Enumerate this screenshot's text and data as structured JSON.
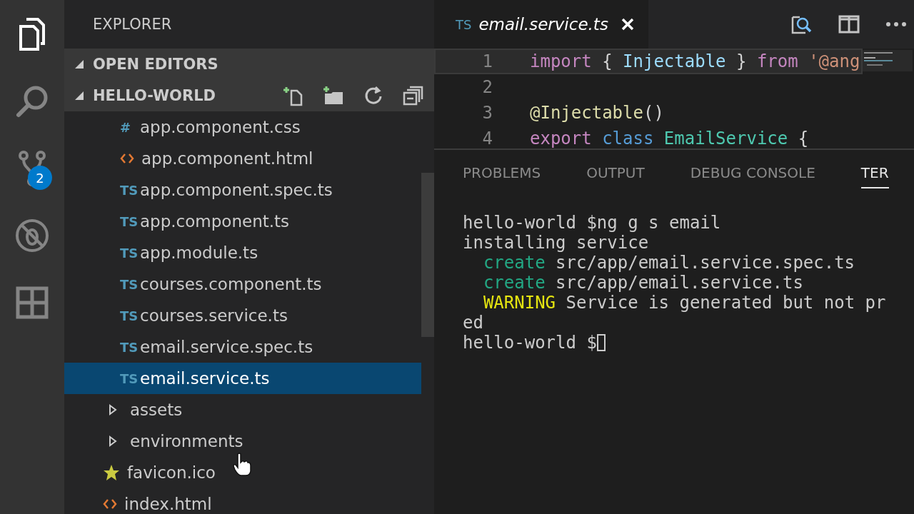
{
  "activity_bar": {
    "items": [
      {
        "kind": "files",
        "selected": true
      },
      {
        "kind": "search",
        "selected": false
      },
      {
        "kind": "scm",
        "selected": false,
        "badge": "2"
      },
      {
        "kind": "debug",
        "selected": false
      },
      {
        "kind": "extensions",
        "selected": false
      }
    ]
  },
  "sidebar": {
    "title": "EXPLORER",
    "sections": [
      {
        "label": "OPEN EDITORS",
        "expanded": true
      },
      {
        "label": "HELLO-WORLD",
        "expanded": true
      }
    ],
    "files": [
      {
        "name": "app.component.css",
        "kind": "css",
        "icon": "#",
        "selected": false
      },
      {
        "name": "app.component.html",
        "kind": "html",
        "selected": false
      },
      {
        "name": "app.component.spec.ts",
        "kind": "ts",
        "icon": "TS",
        "selected": false
      },
      {
        "name": "app.component.ts",
        "kind": "ts",
        "icon": "TS",
        "selected": false
      },
      {
        "name": "app.module.ts",
        "kind": "ts",
        "icon": "TS",
        "selected": false
      },
      {
        "name": "courses.component.ts",
        "kind": "ts",
        "icon": "TS",
        "selected": false
      },
      {
        "name": "courses.service.ts",
        "kind": "ts",
        "icon": "TS",
        "selected": false
      },
      {
        "name": "email.service.spec.ts",
        "kind": "ts",
        "icon": "TS",
        "selected": false
      },
      {
        "name": "email.service.ts",
        "kind": "ts",
        "icon": "TS",
        "selected": true
      },
      {
        "name": "assets",
        "kind": "folder",
        "expanded": false,
        "selected": false
      },
      {
        "name": "environments",
        "kind": "folder",
        "expanded": false,
        "selected": false
      },
      {
        "name": "favicon.ico",
        "kind": "favicon",
        "selected": false
      },
      {
        "name": "index.html",
        "kind": "html",
        "selected": false
      }
    ]
  },
  "editor": {
    "tab": {
      "icon": "TS",
      "title": "email.service.ts",
      "preview": true
    },
    "lines": [
      {
        "number": "1",
        "current": true,
        "tokens": [
          {
            "text": "import",
            "kind": "keyword"
          },
          {
            "text": " { ",
            "kind": "plain"
          },
          {
            "text": "Injectable",
            "kind": "variable"
          },
          {
            "text": " } ",
            "kind": "plain"
          },
          {
            "text": "from",
            "kind": "keyword"
          },
          {
            "text": " '@ang",
            "kind": "string"
          }
        ]
      },
      {
        "number": "2",
        "current": false
      },
      {
        "number": "3",
        "current": false,
        "tokens": [
          {
            "text": "@Injectable",
            "kind": "function"
          },
          {
            "text": "()",
            "kind": "plain"
          }
        ]
      },
      {
        "number": "4",
        "current": false,
        "tokens": [
          {
            "text": "export",
            "kind": "keyword"
          },
          {
            "text": " class",
            "kind": "storage"
          },
          {
            "text": " EmailService",
            "kind": "type"
          },
          {
            "text": " {",
            "kind": "plain"
          }
        ]
      }
    ]
  },
  "panel": {
    "tabs": [
      {
        "label": "PROBLEMS",
        "selected": false
      },
      {
        "label": "OUTPUT",
        "selected": false
      },
      {
        "label": "DEBUG CONSOLE",
        "selected": false
      },
      {
        "label": "TER",
        "selected": true
      }
    ],
    "terminal": [
      {
        "segments": [
          {
            "text": "hello-world $ng g s email",
            "kind": "plain"
          }
        ]
      },
      {
        "segments": [
          {
            "text": "installing service",
            "kind": "plain"
          }
        ]
      },
      {
        "segments": [
          {
            "text": "  create",
            "kind": "create"
          },
          {
            "text": " src/app/email.service.spec.ts",
            "kind": "plain"
          }
        ]
      },
      {
        "segments": [
          {
            "text": "  create",
            "kind": "create"
          },
          {
            "text": " src/app/email.service.ts",
            "kind": "plain"
          }
        ]
      },
      {
        "segments": [
          {
            "text": "  WARNING",
            "kind": "warning"
          },
          {
            "text": " Service is generated but not pr",
            "kind": "plain"
          }
        ]
      },
      {
        "segments": [
          {
            "text": "ed",
            "kind": "plain"
          }
        ]
      },
      {
        "segments": [
          {
            "text": "hello-world $",
            "kind": "plain"
          }
        ],
        "cursor": true
      }
    ]
  }
}
